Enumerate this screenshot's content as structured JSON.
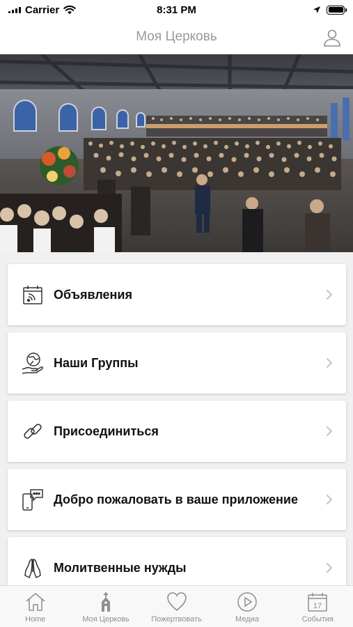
{
  "status_bar": {
    "carrier": "Carrier",
    "time": "8:31 PM"
  },
  "header": {
    "title": "Моя Церковь",
    "profile_icon": "person-icon"
  },
  "hero": {
    "description_icon": "church-congregation-photo"
  },
  "menu": [
    {
      "label": "Объявления",
      "icon": "calendar-feed-icon"
    },
    {
      "label": "Наши Группы",
      "icon": "globe-hand-icon"
    },
    {
      "label": "Присоединиться",
      "icon": "link-icon"
    },
    {
      "label": "Добро пожаловать в ваше приложение",
      "icon": "phone-chat-icon"
    },
    {
      "label": "Молитвенные нужды",
      "icon": "praying-hands-icon"
    }
  ],
  "tabs": [
    {
      "label": "Home",
      "icon": "home-icon"
    },
    {
      "label": "Моя Церковь",
      "icon": "church-icon"
    },
    {
      "label": "Пожертвовать",
      "icon": "heart-icon"
    },
    {
      "label": "Медиа",
      "icon": "play-icon"
    },
    {
      "label": "События",
      "icon": "calendar-icon",
      "date": "17"
    }
  ]
}
